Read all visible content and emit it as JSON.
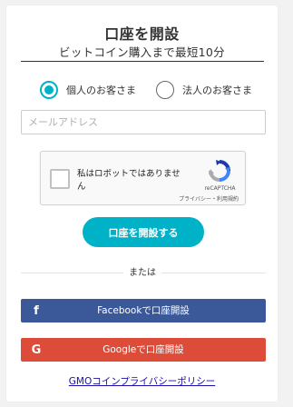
{
  "header": {
    "title": "口座を開設",
    "subtitle": "ビットコイン購入まで最短10分"
  },
  "account_type": {
    "options": [
      {
        "label": "個人のお客さま",
        "selected": true
      },
      {
        "label": "法人のお客さま",
        "selected": false
      }
    ]
  },
  "email": {
    "placeholder": "メールアドレス",
    "value": ""
  },
  "recaptcha": {
    "checkbox_label": "私はロボットではありません",
    "brand": "reCAPTCHA",
    "links": "プライバシー・利用規約",
    "checked": false
  },
  "open_button_label": "口座を開設する",
  "or_label": "または",
  "social": {
    "facebook_label": "Facebookで口座開設",
    "google_label": "Googleで口座開設"
  },
  "footer_link": "GMOコインプライバシーポリシー",
  "colors": {
    "accent": "#00b2c8",
    "facebook": "#3b5998",
    "google": "#dd4b39"
  },
  "icons": {
    "facebook": "facebook-icon",
    "google": "google-icon",
    "recaptcha": "recaptcha-logo-icon"
  }
}
